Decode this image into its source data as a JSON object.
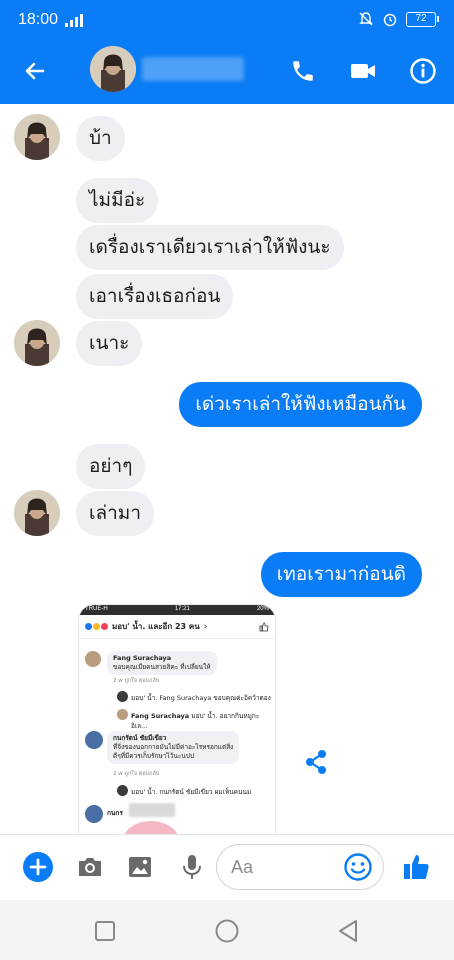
{
  "status_bar": {
    "time": "18:00",
    "battery": "72"
  },
  "header": {
    "contact_name": ""
  },
  "messages": {
    "m1": "บ้า",
    "m2": "ไม่มีอ่ะ",
    "m3": "เดรื่องเราเดียวเราเล่าให้ฟังนะ",
    "m4": "เอาเรื่องเธอก่อน",
    "m5": "เนาะ",
    "m6": "เด่วเราเล่าให้ฟังเหมือนกัน",
    "m7": "อย่าๆ",
    "m8": "เล่ามา",
    "m9": "เทอเรามาก่อนดิ"
  },
  "shared_screenshot": {
    "carrier": "TRUE-H",
    "time": "17:21",
    "battery": "20%",
    "reactors": "มอบ' น้ำ. และอีก 23 คน",
    "c1_name": "Fang Surachaya",
    "c1_text": "ขอบคุณเมียคนสวยสิคะ ที่เปลี่ยนให้",
    "c1_meta": "2 w     ถูกใจ     ตอบกลับ",
    "r1_text": "มอบ' น้ำ. Fang Surachaya ขอบคุณค่ะอิคว้าตอง",
    "r2_name": "Fang Surachaya",
    "r2_text": "มอบ' น้ำ. อยากกินหมูกะอิเล...",
    "c2_name": "กนกรัตน์ ชัยมีเขียว",
    "c2_text_1": "ที่จิ่งของนอกกายมันไม่มีค่าอะไรหรอกแต่สิ่ง",
    "c2_text_2": "ดีๆที่มีควรเก็บรักษาไว้นะนปป",
    "c2_meta": "2 w     ถูกใจ     ตอบกลับ",
    "r3_text": "มอบ' น้ำ. กนกรัตน์ ชัยมีเขียว ผมเห็นคนนม",
    "c3_name": "กนกร"
  },
  "composer": {
    "placeholder": "Aa"
  },
  "colors": {
    "messenger_blue": "#0a7cf5",
    "incoming_bubble": "#eeeff2"
  }
}
